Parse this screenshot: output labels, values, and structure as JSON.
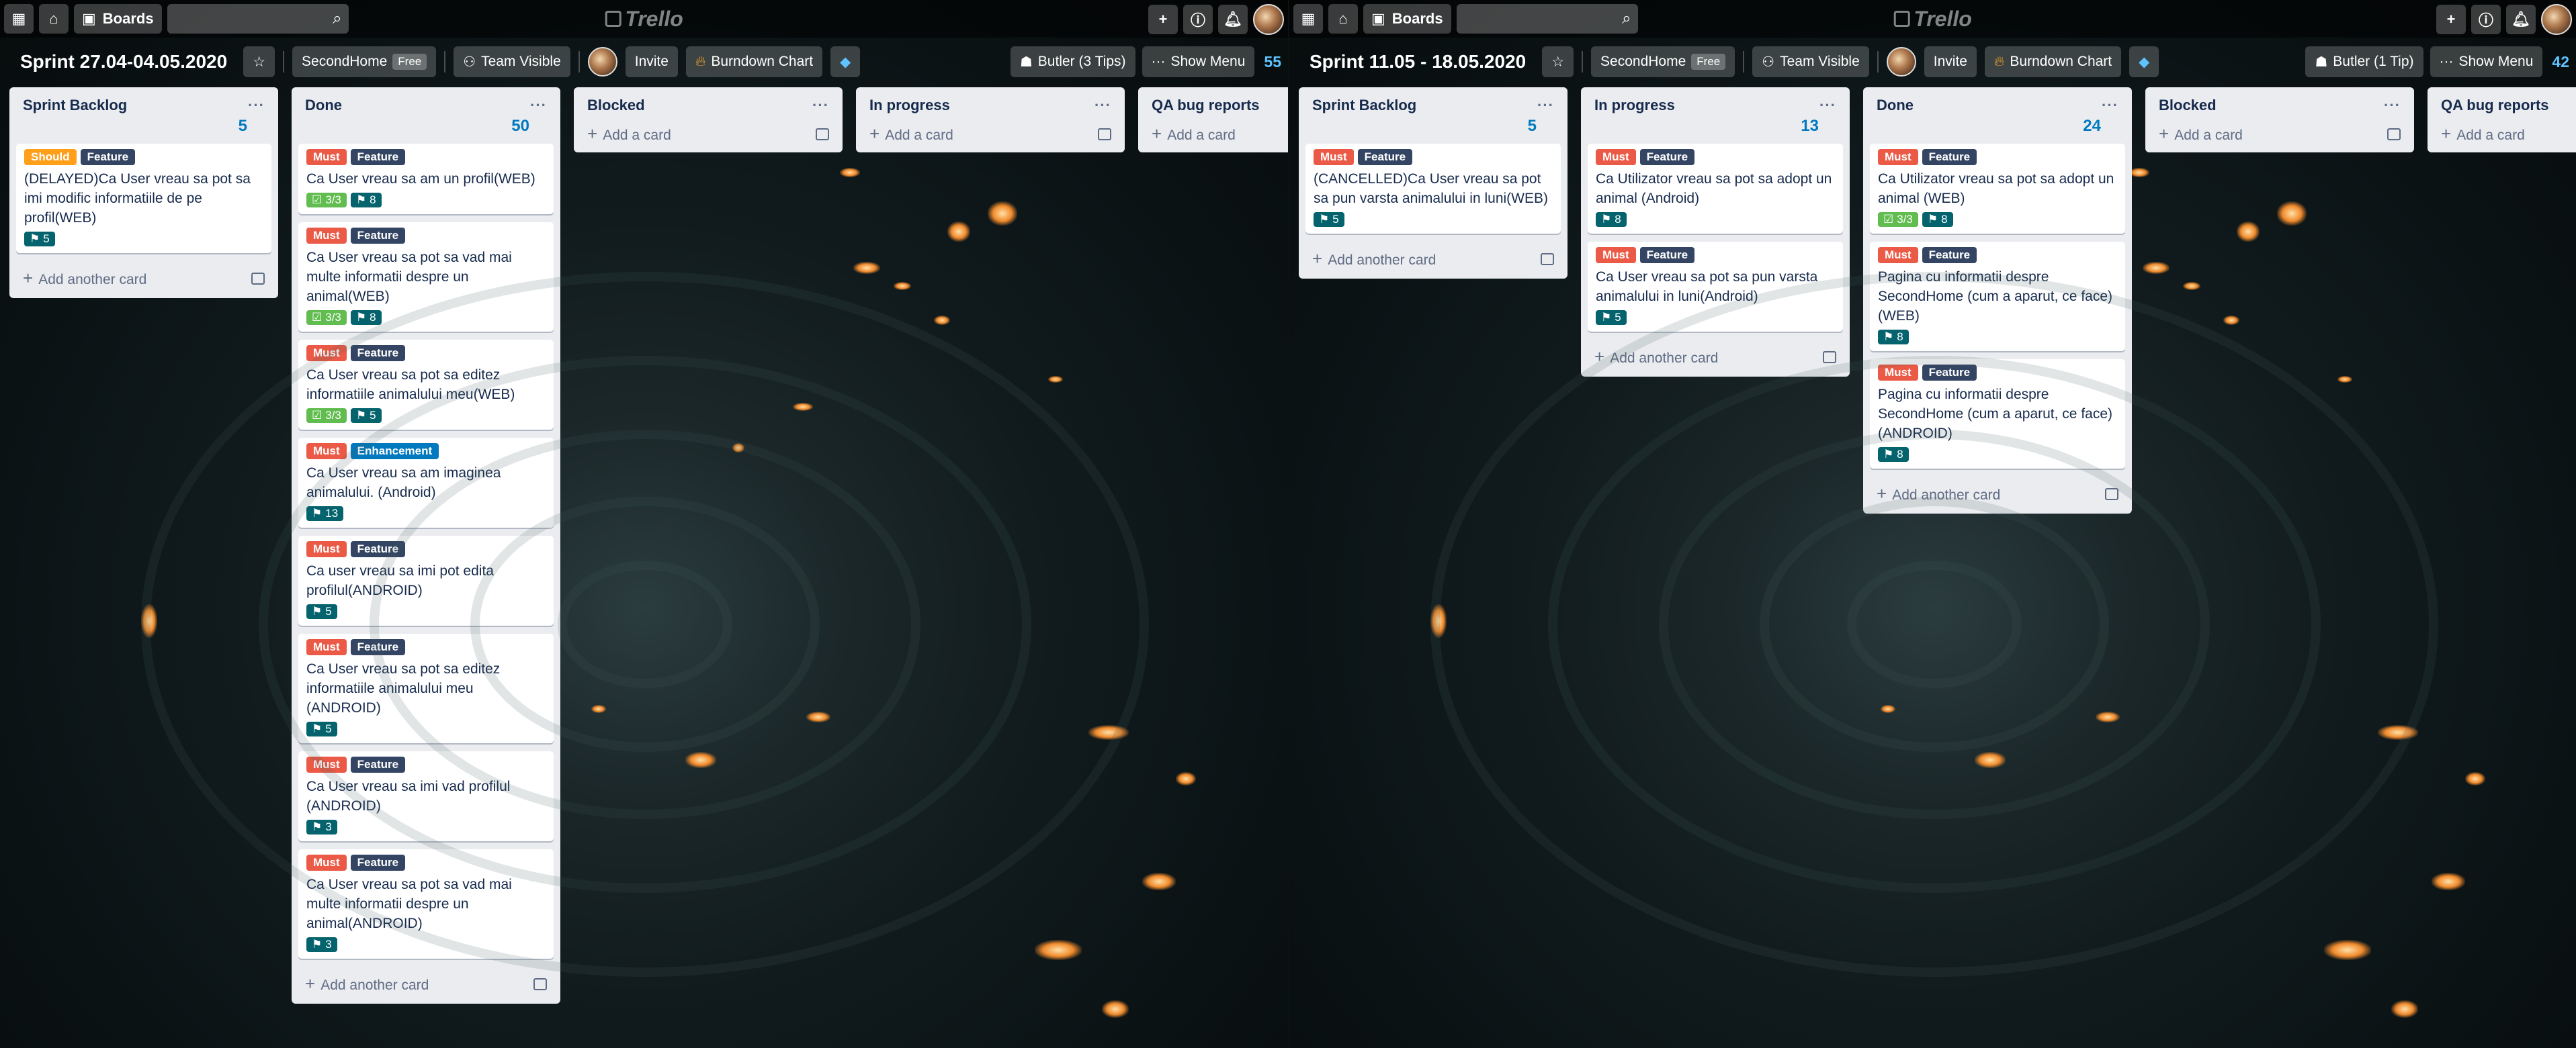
{
  "colors": {
    "must": "#eb5a46",
    "should": "#ff9f1a",
    "feature": "#344563",
    "enhancement": "#0079bf",
    "checklist_done": "#61bd4f",
    "points": "#05636e",
    "counter": "#0079bf"
  },
  "boards": [
    {
      "topbar": {
        "boards_label": "Boards",
        "logo": "Trello"
      },
      "header": {
        "title": "Sprint 27.04-04.05.2020",
        "team": "SecondHome",
        "team_badge": "Free",
        "visibility": "Team Visible",
        "invite": "Invite",
        "powerup": "Burndown Chart",
        "butler": "Butler (3 Tips)",
        "menu": "Show Menu",
        "total": "55"
      },
      "lists": [
        {
          "title": "Sprint Backlog",
          "count": "5",
          "add_label": "Add another card",
          "cards": [
            {
              "labels": [
                {
                  "text": "Should",
                  "color": "#ff9f1a"
                },
                {
                  "text": "Feature",
                  "color": "#344563"
                }
              ],
              "title": "(DELAYED)Ca User vreau sa pot sa imi modific informatiile de pe profil(WEB)",
              "checklist": "",
              "points": "5"
            }
          ]
        },
        {
          "title": "Done",
          "count": "50",
          "add_label": "Add another card",
          "cards": [
            {
              "labels": [
                {
                  "text": "Must",
                  "color": "#eb5a46"
                },
                {
                  "text": "Feature",
                  "color": "#344563"
                }
              ],
              "title": "Ca User vreau sa am un profil(WEB)",
              "checklist": "3/3",
              "points": "8"
            },
            {
              "labels": [
                {
                  "text": "Must",
                  "color": "#eb5a46"
                },
                {
                  "text": "Feature",
                  "color": "#344563"
                }
              ],
              "title": "Ca User vreau sa pot sa vad mai multe informatii despre un animal(WEB)",
              "checklist": "3/3",
              "points": "8"
            },
            {
              "labels": [
                {
                  "text": "Must",
                  "color": "#eb5a46"
                },
                {
                  "text": "Feature",
                  "color": "#344563"
                }
              ],
              "title": "Ca User vreau sa pot sa editez informatiile animalului meu(WEB)",
              "checklist": "3/3",
              "points": "5"
            },
            {
              "labels": [
                {
                  "text": "Must",
                  "color": "#eb5a46"
                },
                {
                  "text": "Enhancement",
                  "color": "#0079bf"
                }
              ],
              "title": "Ca User vreau sa am imaginea animalului. (Android)",
              "checklist": "",
              "points": "13"
            },
            {
              "labels": [
                {
                  "text": "Must",
                  "color": "#eb5a46"
                },
                {
                  "text": "Feature",
                  "color": "#344563"
                }
              ],
              "title": "Ca user vreau sa imi pot edita profilul(ANDROID)",
              "checklist": "",
              "points": "5"
            },
            {
              "labels": [
                {
                  "text": "Must",
                  "color": "#eb5a46"
                },
                {
                  "text": "Feature",
                  "color": "#344563"
                }
              ],
              "title": "Ca User vreau sa pot sa editez informatiile animalului meu (ANDROID)",
              "checklist": "",
              "points": "5"
            },
            {
              "labels": [
                {
                  "text": "Must",
                  "color": "#eb5a46"
                },
                {
                  "text": "Feature",
                  "color": "#344563"
                }
              ],
              "title": "Ca User vreau sa imi vad profilul (ANDROID)",
              "checklist": "",
              "points": "3"
            },
            {
              "labels": [
                {
                  "text": "Must",
                  "color": "#eb5a46"
                },
                {
                  "text": "Feature",
                  "color": "#344563"
                }
              ],
              "title": "Ca User vreau sa pot sa vad mai multe informatii despre un animal(ANDROID)",
              "checklist": "",
              "points": "3"
            }
          ]
        },
        {
          "title": "Blocked",
          "count": "",
          "add_label": "Add a card",
          "cards": []
        },
        {
          "title": "In progress",
          "count": "",
          "add_label": "Add a card",
          "cards": []
        },
        {
          "title": "QA bug reports",
          "count": "",
          "add_label": "Add a card",
          "cards": []
        }
      ]
    },
    {
      "topbar": {
        "boards_label": "Boards",
        "logo": "Trello"
      },
      "header": {
        "title": "Sprint 11.05 - 18.05.2020",
        "team": "SecondHome",
        "team_badge": "Free",
        "visibility": "Team Visible",
        "invite": "Invite",
        "powerup": "Burndown Chart",
        "butler": "Butler (1 Tip)",
        "menu": "Show Menu",
        "total": "42"
      },
      "lists": [
        {
          "title": "Sprint Backlog",
          "count": "5",
          "add_label": "Add another card",
          "cards": [
            {
              "labels": [
                {
                  "text": "Must",
                  "color": "#eb5a46"
                },
                {
                  "text": "Feature",
                  "color": "#344563"
                }
              ],
              "title": "(CANCELLED)Ca User vreau sa pot sa pun varsta animalului in luni(WEB)",
              "checklist": "",
              "points": "5"
            }
          ]
        },
        {
          "title": "In progress",
          "count": "13",
          "add_label": "Add another card",
          "cards": [
            {
              "labels": [
                {
                  "text": "Must",
                  "color": "#eb5a46"
                },
                {
                  "text": "Feature",
                  "color": "#344563"
                }
              ],
              "title": "Ca Utilizator vreau sa pot sa adopt un animal (Android)",
              "checklist": "",
              "points": "8"
            },
            {
              "labels": [
                {
                  "text": "Must",
                  "color": "#eb5a46"
                },
                {
                  "text": "Feature",
                  "color": "#344563"
                }
              ],
              "title": "Ca User vreau sa pot sa pun varsta animalului in luni(Android)",
              "checklist": "",
              "points": "5"
            }
          ]
        },
        {
          "title": "Done",
          "count": "24",
          "add_label": "Add another card",
          "cards": [
            {
              "labels": [
                {
                  "text": "Must",
                  "color": "#eb5a46"
                },
                {
                  "text": "Feature",
                  "color": "#344563"
                }
              ],
              "title": "Ca Utilizator vreau sa pot sa adopt un animal (WEB)",
              "checklist": "3/3",
              "points": "8"
            },
            {
              "labels": [
                {
                  "text": "Must",
                  "color": "#eb5a46"
                },
                {
                  "text": "Feature",
                  "color": "#344563"
                }
              ],
              "title": "Pagina cu informatii despre SecondHome (cum a aparut, ce face) (WEB)",
              "checklist": "",
              "points": "8"
            },
            {
              "labels": [
                {
                  "text": "Must",
                  "color": "#eb5a46"
                },
                {
                  "text": "Feature",
                  "color": "#344563"
                }
              ],
              "title": "Pagina cu informatii despre SecondHome (cum a aparut, ce face) (ANDROID)",
              "checklist": "",
              "points": "8"
            }
          ]
        },
        {
          "title": "Blocked",
          "count": "",
          "add_label": "Add a card",
          "cards": []
        },
        {
          "title": "QA bug reports",
          "count": "",
          "add_label": "Add a card",
          "cards": []
        }
      ]
    }
  ]
}
